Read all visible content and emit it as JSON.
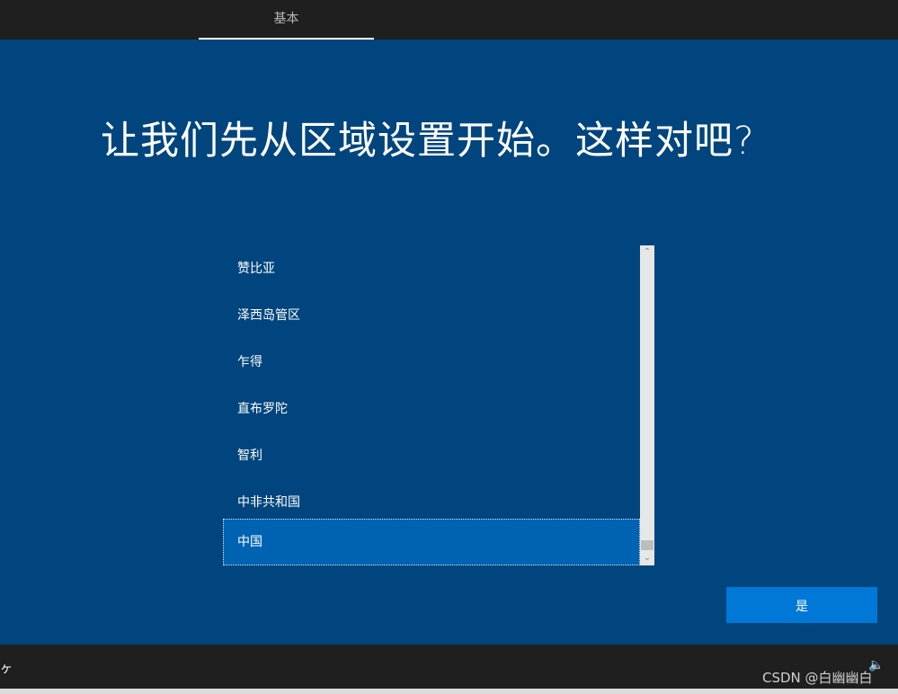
{
  "header": {
    "tab_label": "基本"
  },
  "main": {
    "heading": "让我们先从区域设置开始。这样对吧?",
    "region_list": {
      "items": [
        "赞比亚",
        "泽西岛管区",
        "乍得",
        "直布罗陀",
        "智利",
        "中非共和国",
        "中国"
      ],
      "selected_index": 6
    },
    "scrollbar": {
      "up_glyph": "⌃",
      "down_glyph": "⌄"
    }
  },
  "actions": {
    "yes_label": "是"
  },
  "footer": {
    "ease_icon_glyph": "ヶ",
    "volume_icon_glyph": "🔈",
    "watermark": "CSDN @白幽幽白"
  },
  "colors": {
    "background": "#00457d",
    "selected_item": "#0063b1",
    "button": "#0078d7",
    "bar": "#1f1f1f"
  }
}
